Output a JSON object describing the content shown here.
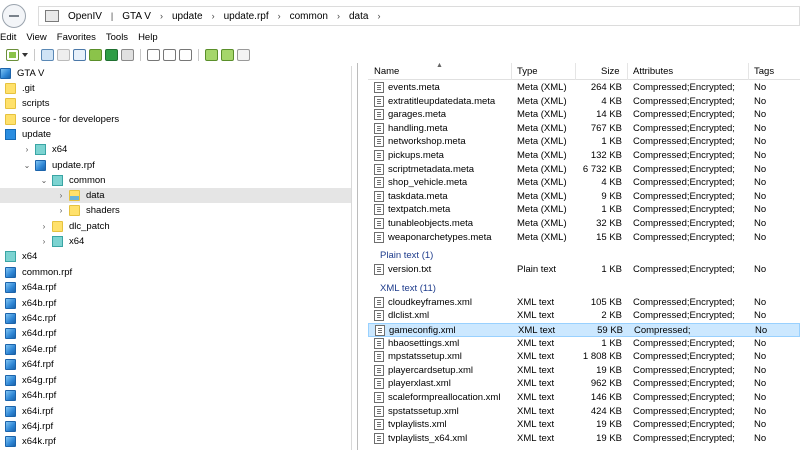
{
  "breadcrumb": [
    "OpenIV",
    "GTA V",
    "update",
    "update.rpf",
    "common",
    "data"
  ],
  "menu": [
    "Edit",
    "View",
    "Favorites",
    "Tools",
    "Help"
  ],
  "tree": [
    {
      "label": "GTA V",
      "icon": "rpf-icon",
      "indent": 0,
      "chevron": ""
    },
    {
      "label": ".git",
      "icon": "folder-icon",
      "indent": 0,
      "chevron": ""
    },
    {
      "label": "scripts",
      "icon": "folder-icon",
      "indent": 0,
      "chevron": ""
    },
    {
      "label": "source - for developers",
      "icon": "folder-icon",
      "indent": 0,
      "chevron": ""
    },
    {
      "label": "update",
      "icon": "blue-folder-icon",
      "indent": 0,
      "chevron": ""
    },
    {
      "label": "x64",
      "icon": "teal-folder-icon",
      "indent": 1,
      "chevron": ">"
    },
    {
      "label": "update.rpf",
      "icon": "rpf-icon",
      "indent": 1,
      "chevron": "v"
    },
    {
      "label": "common",
      "icon": "teal-folder-icon",
      "indent": 2,
      "chevron": "v"
    },
    {
      "label": "data",
      "icon": "open-folder-icon",
      "indent": 3,
      "chevron": ">",
      "selected": true
    },
    {
      "label": "shaders",
      "icon": "folder-icon",
      "indent": 3,
      "chevron": ">"
    },
    {
      "label": "dlc_patch",
      "icon": "folder-icon",
      "indent": 2,
      "chevron": ">"
    },
    {
      "label": "x64",
      "icon": "teal-folder-icon",
      "indent": 2,
      "chevron": ">"
    },
    {
      "label": "x64",
      "icon": "teal-folder-icon",
      "indent": 0,
      "chevron": ""
    },
    {
      "label": "common.rpf",
      "icon": "rpf-icon",
      "indent": 0,
      "chevron": ""
    },
    {
      "label": "x64a.rpf",
      "icon": "rpf-icon",
      "indent": 0,
      "chevron": ""
    },
    {
      "label": "x64b.rpf",
      "icon": "rpf-icon",
      "indent": 0,
      "chevron": ""
    },
    {
      "label": "x64c.rpf",
      "icon": "rpf-icon",
      "indent": 0,
      "chevron": ""
    },
    {
      "label": "x64d.rpf",
      "icon": "rpf-icon",
      "indent": 0,
      "chevron": ""
    },
    {
      "label": "x64e.rpf",
      "icon": "rpf-icon",
      "indent": 0,
      "chevron": ""
    },
    {
      "label": "x64f.rpf",
      "icon": "rpf-icon",
      "indent": 0,
      "chevron": ""
    },
    {
      "label": "x64g.rpf",
      "icon": "rpf-icon",
      "indent": 0,
      "chevron": ""
    },
    {
      "label": "x64h.rpf",
      "icon": "rpf-icon",
      "indent": 0,
      "chevron": ""
    },
    {
      "label": "x64i.rpf",
      "icon": "rpf-icon",
      "indent": 0,
      "chevron": ""
    },
    {
      "label": "x64j.rpf",
      "icon": "rpf-icon",
      "indent": 0,
      "chevron": ""
    },
    {
      "label": "x64k.rpf",
      "icon": "rpf-icon",
      "indent": 0,
      "chevron": ""
    }
  ],
  "columns": {
    "name": "Name",
    "type": "Type",
    "size": "Size",
    "attributes": "Attributes",
    "tags": "Tags"
  },
  "meta_files": [
    {
      "name": "events.meta",
      "type": "Meta (XML)",
      "size": "264 KB",
      "attr": "Compressed;Encrypted;",
      "tags": "No"
    },
    {
      "name": "extratitleupdatedata.meta",
      "type": "Meta (XML)",
      "size": "4 KB",
      "attr": "Compressed;Encrypted;",
      "tags": "No"
    },
    {
      "name": "garages.meta",
      "type": "Meta (XML)",
      "size": "14 KB",
      "attr": "Compressed;Encrypted;",
      "tags": "No"
    },
    {
      "name": "handling.meta",
      "type": "Meta (XML)",
      "size": "767 KB",
      "attr": "Compressed;Encrypted;",
      "tags": "No"
    },
    {
      "name": "networkshop.meta",
      "type": "Meta (XML)",
      "size": "1 KB",
      "attr": "Compressed;Encrypted;",
      "tags": "No"
    },
    {
      "name": "pickups.meta",
      "type": "Meta (XML)",
      "size": "132 KB",
      "attr": "Compressed;Encrypted;",
      "tags": "No"
    },
    {
      "name": "scriptmetadata.meta",
      "type": "Meta (XML)",
      "size": "6 732 KB",
      "attr": "Compressed;Encrypted;",
      "tags": "No"
    },
    {
      "name": "shop_vehicle.meta",
      "type": "Meta (XML)",
      "size": "4 KB",
      "attr": "Compressed;Encrypted;",
      "tags": "No"
    },
    {
      "name": "taskdata.meta",
      "type": "Meta (XML)",
      "size": "9 KB",
      "attr": "Compressed;Encrypted;",
      "tags": "No"
    },
    {
      "name": "textpatch.meta",
      "type": "Meta (XML)",
      "size": "1 KB",
      "attr": "Compressed;Encrypted;",
      "tags": "No"
    },
    {
      "name": "tunableobjects.meta",
      "type": "Meta (XML)",
      "size": "32 KB",
      "attr": "Compressed;Encrypted;",
      "tags": "No"
    },
    {
      "name": "weaponarchetypes.meta",
      "type": "Meta (XML)",
      "size": "15 KB",
      "attr": "Compressed;Encrypted;",
      "tags": "No"
    }
  ],
  "group_plain": "Plain text (1)",
  "plain_files": [
    {
      "name": "version.txt",
      "type": "Plain text",
      "size": "1 KB",
      "attr": "Compressed;Encrypted;",
      "tags": "No"
    }
  ],
  "group_xml": "XML text (11)",
  "xml_files": [
    {
      "name": "cloudkeyframes.xml",
      "type": "XML text",
      "size": "105 KB",
      "attr": "Compressed;Encrypted;",
      "tags": "No"
    },
    {
      "name": "dlclist.xml",
      "type": "XML text",
      "size": "2 KB",
      "attr": "Compressed;Encrypted;",
      "tags": "No"
    },
    {
      "name": "gameconfig.xml",
      "type": "XML text",
      "size": "59 KB",
      "attr": "Compressed;",
      "tags": "No",
      "selected": true
    },
    {
      "name": "hbaosettings.xml",
      "type": "XML text",
      "size": "1 KB",
      "attr": "Compressed;Encrypted;",
      "tags": "No"
    },
    {
      "name": "mpstatssetup.xml",
      "type": "XML text",
      "size": "1 808 KB",
      "attr": "Compressed;Encrypted;",
      "tags": "No"
    },
    {
      "name": "playercardsetup.xml",
      "type": "XML text",
      "size": "19 KB",
      "attr": "Compressed;Encrypted;",
      "tags": "No"
    },
    {
      "name": "playerxlast.xml",
      "type": "XML text",
      "size": "962 KB",
      "attr": "Compressed;Encrypted;",
      "tags": "No"
    },
    {
      "name": "scaleformpreallocation.xml",
      "type": "XML text",
      "size": "146 KB",
      "attr": "Compressed;Encrypted;",
      "tags": "No"
    },
    {
      "name": "spstatssetup.xml",
      "type": "XML text",
      "size": "424 KB",
      "attr": "Compressed;Encrypted;",
      "tags": "No"
    },
    {
      "name": "tvplaylists.xml",
      "type": "XML text",
      "size": "19 KB",
      "attr": "Compressed;Encrypted;",
      "tags": "No"
    },
    {
      "name": "tvplaylists_x64.xml",
      "type": "XML text",
      "size": "19 KB",
      "attr": "Compressed;Encrypted;",
      "tags": "No"
    }
  ],
  "colors": {
    "selection": "#cce8ff",
    "tree_selection": "#e5e5e5",
    "group_header": "#1e3c8c"
  }
}
